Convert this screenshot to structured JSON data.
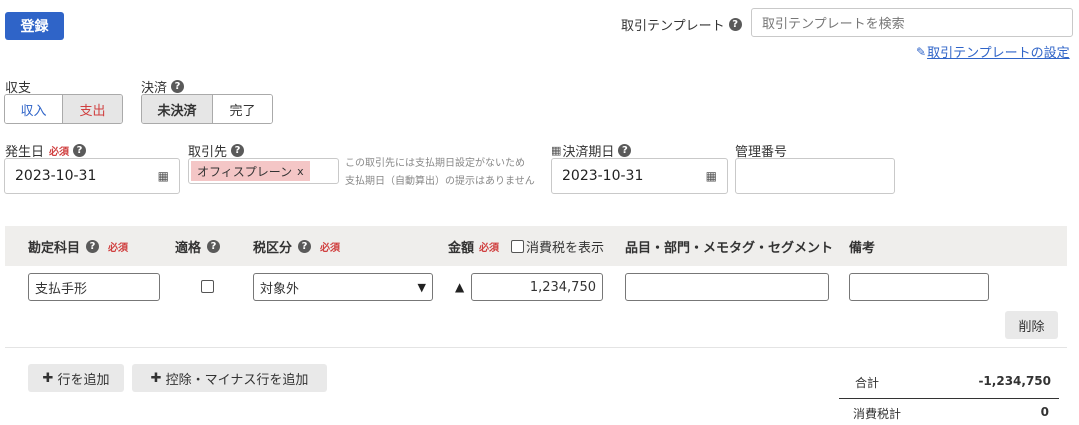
{
  "header": {
    "register_label": "登録",
    "template_label": "取引テンプレート",
    "template_search_placeholder": "取引テンプレートを検索",
    "template_settings_link": "取引テンプレートの設定"
  },
  "income_expense": {
    "label": "収支",
    "options": [
      "収入",
      "支出"
    ],
    "selected": "支出"
  },
  "settlement": {
    "label": "決済",
    "options": [
      "未決済",
      "完了"
    ],
    "selected": "未決済"
  },
  "issue_date": {
    "label": "発生日",
    "required": "必須",
    "value": "2023-10-31"
  },
  "partner": {
    "label": "取引先",
    "tag": "オフィスプレーン",
    "tag_remove": "x",
    "note_line1": "この取引先には支払期日設定がないため",
    "note_line2": "支払期日（自動算出）の提示はありません"
  },
  "due_date": {
    "label": "決済期日",
    "value": "2023-10-31"
  },
  "management_number": {
    "label": "管理番号",
    "value": ""
  },
  "table": {
    "headers": {
      "account": "勘定科目",
      "qualified": "適格",
      "tax_category": "税区分",
      "amount": "金額",
      "show_tax": "消費税を表示",
      "items": "品目・部門・メモタグ・セグメント",
      "remarks": "備考"
    },
    "required": "必須",
    "row": {
      "account": "支払手形",
      "qualified": false,
      "tax_category": "対象外",
      "amount_prefix": "▲",
      "amount": "1,234,750",
      "items": "",
      "remarks": ""
    },
    "delete_label": "削除"
  },
  "actions": {
    "add_row": "行を追加",
    "add_deduction_row": "控除・マイナス行を追加"
  },
  "totals": {
    "total_label": "合計",
    "total_value": "-1,234,750",
    "tax_label": "消費税計",
    "tax_value": "0"
  },
  "colors": {
    "primary": "#2f64c8",
    "required": "#d04040",
    "tag_bg": "#f4c6c6",
    "header_bg": "#efeeec"
  }
}
